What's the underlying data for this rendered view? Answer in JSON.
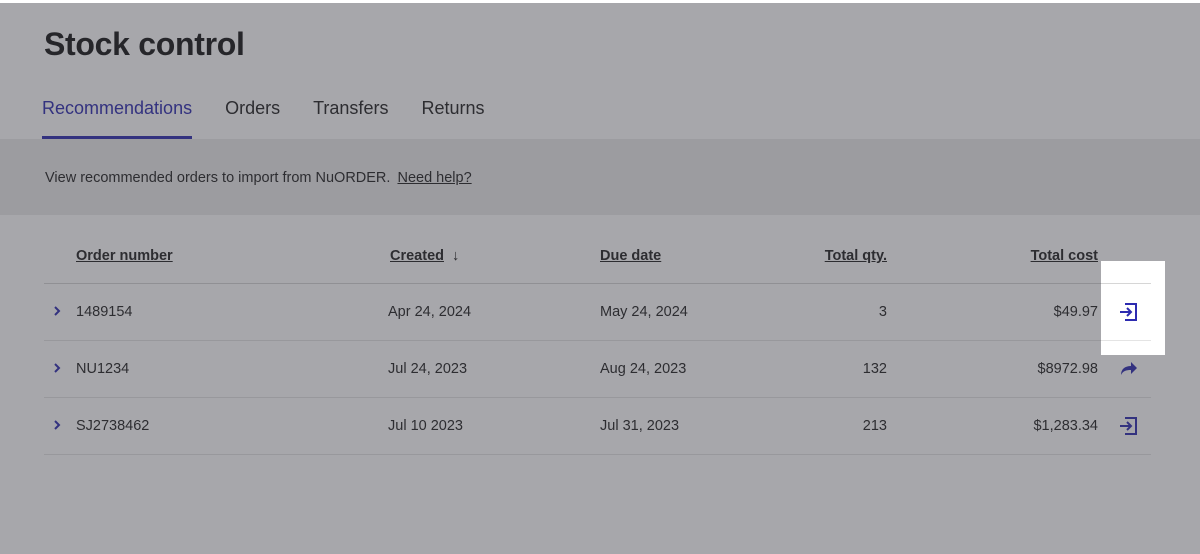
{
  "page": {
    "title": "Stock control",
    "tabs": [
      "Recommendations",
      "Orders",
      "Transfers",
      "Returns"
    ],
    "active_tab": "Recommendations"
  },
  "info_bar": {
    "text": "View recommended orders to import from NuORDER.",
    "help_link": "Need help?"
  },
  "table": {
    "headers": {
      "order_number": "Order number",
      "created": "Created",
      "created_sort": "↓",
      "due_date": "Due date",
      "total_qty": "Total qty.",
      "total_cost": "Total cost"
    },
    "rows": [
      {
        "order_number": "1489154",
        "created": "Apr 24, 2024",
        "due_date": "May 24, 2024",
        "total_qty": "3",
        "total_cost": "$49.97",
        "action_icon": "import-icon"
      },
      {
        "order_number": "NU1234",
        "created": "Jul 24, 2023",
        "due_date": "Aug 24, 2023",
        "total_qty": "132",
        "total_cost": "$8972.98",
        "action_icon": "share-arrow-icon"
      },
      {
        "order_number": "SJ2738462",
        "created": "Jul 10 2023",
        "due_date": "Jul 31, 2023",
        "total_qty": "213",
        "total_cost": "$1,283.34",
        "action_icon": "import-icon"
      }
    ]
  },
  "colors": {
    "accent": "#2d2bb0",
    "overlay": "#3c3c44",
    "info_bar_bg": "#ececec"
  }
}
